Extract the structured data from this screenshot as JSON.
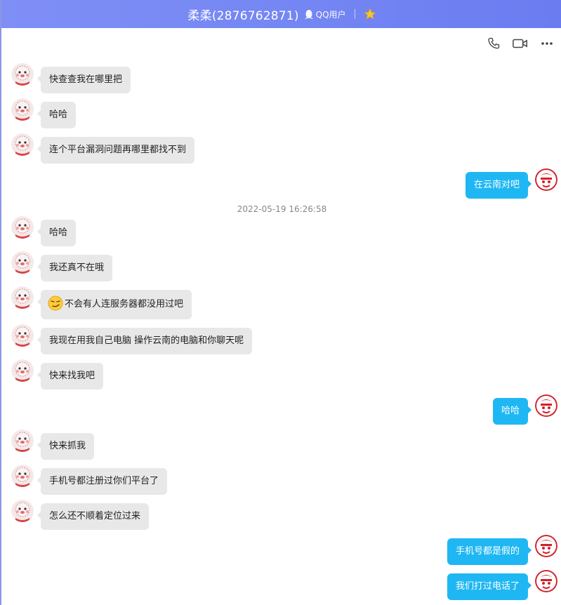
{
  "header": {
    "title": "柔柔(2876762871)",
    "user_type": "QQ用户"
  },
  "colors": {
    "titlebar": "#7486f3",
    "incoming_bubble": "#e8e8e8",
    "outgoing_bubble": "#1fb7f3"
  },
  "toolbar": {
    "call_icon": "phone-icon",
    "video_icon": "video-camera-icon",
    "more_icon": "more-icon"
  },
  "messages": [
    {
      "side": "left",
      "text": "快查查我在哪里把"
    },
    {
      "side": "left",
      "text": "哈哈"
    },
    {
      "side": "left",
      "text": "连个平台漏洞问题再哪里都找不到"
    },
    {
      "side": "right",
      "text": "在云南对吧"
    },
    {
      "side": "left",
      "text": "哈哈"
    },
    {
      "side": "left",
      "text": "我还真不在哦"
    },
    {
      "side": "left",
      "text": "不会有人连服务器都没用过吧",
      "emoji": "smirk-emoji"
    },
    {
      "side": "left",
      "text": "我现在用我自己电脑 操作云南的电脑和你聊天呢"
    },
    {
      "side": "left",
      "text": "快来找我吧"
    },
    {
      "side": "right",
      "text": "哈哈"
    },
    {
      "side": "left",
      "text": "快来抓我"
    },
    {
      "side": "left",
      "text": "手机号都注册过你们平台了"
    },
    {
      "side": "left",
      "text": "怎么还不顺着定位过来"
    },
    {
      "side": "right",
      "text": "手机号都是假的"
    },
    {
      "side": "right",
      "text": "我们打过电话了"
    }
  ],
  "timestamp": "2022-05-19 16:26:58"
}
